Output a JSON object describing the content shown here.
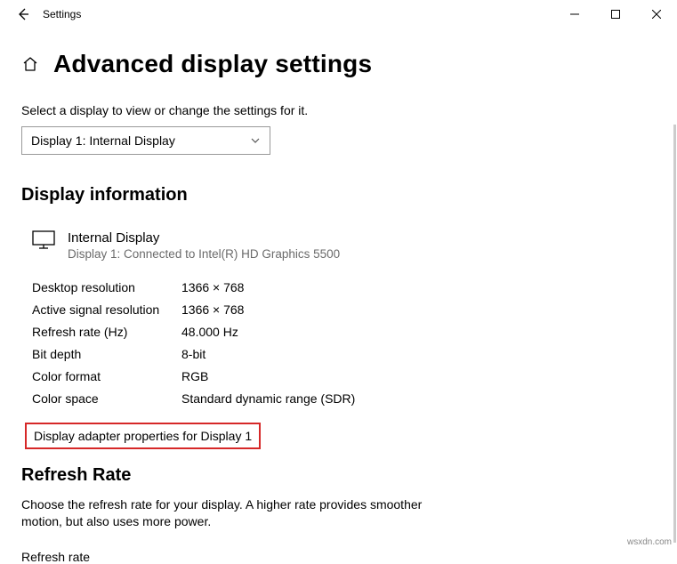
{
  "window": {
    "title": "Settings"
  },
  "header": {
    "page_title": "Advanced display settings"
  },
  "display_select": {
    "label": "Select a display to view or change the settings for it.",
    "selected": "Display 1: Internal Display"
  },
  "info_section": {
    "heading": "Display information",
    "display_name": "Internal Display",
    "display_sub": "Display 1: Connected to Intel(R) HD Graphics 5500",
    "specs": [
      {
        "label": "Desktop resolution",
        "value": "1366 × 768"
      },
      {
        "label": "Active signal resolution",
        "value": "1366 × 768"
      },
      {
        "label": "Refresh rate (Hz)",
        "value": "48.000 Hz"
      },
      {
        "label": "Bit depth",
        "value": "8-bit"
      },
      {
        "label": "Color format",
        "value": "RGB"
      },
      {
        "label": "Color space",
        "value": "Standard dynamic range (SDR)"
      }
    ],
    "adapter_link": "Display adapter properties for Display 1"
  },
  "refresh_section": {
    "heading": "Refresh Rate",
    "description": "Choose the refresh rate for your display. A higher rate provides smoother motion, but also uses more power.",
    "sub_label": "Refresh rate"
  },
  "watermark": "wsxdn.com"
}
